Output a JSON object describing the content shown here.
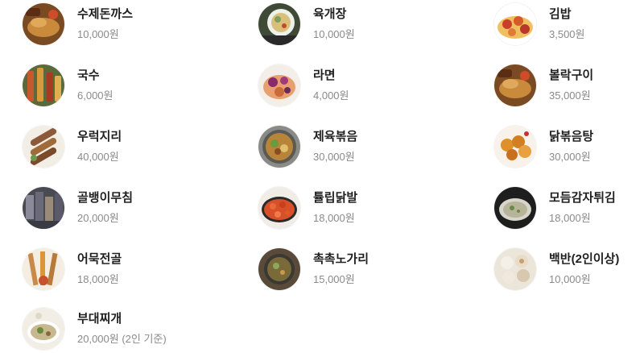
{
  "menu": {
    "items": [
      {
        "name": "수제돈까스",
        "price": "10,000원",
        "icon": "pork-cutlet-photo"
      },
      {
        "name": "육개장",
        "price": "10,000원",
        "icon": "spicy-beef-soup-photo"
      },
      {
        "name": "김밥",
        "price": "3,500원",
        "icon": "gimbap-photo"
      },
      {
        "name": "국수",
        "price": "6,000원",
        "icon": "noodles-photo"
      },
      {
        "name": "라면",
        "price": "4,000원",
        "icon": "ramen-photo"
      },
      {
        "name": "볼락구이",
        "price": "35,000원",
        "icon": "grilled-rockfish-photo"
      },
      {
        "name": "우럭지리",
        "price": "40,000원",
        "icon": "rockfish-soup-photo"
      },
      {
        "name": "제육볶음",
        "price": "30,000원",
        "icon": "stir-fried-pork-photo"
      },
      {
        "name": "닭볶음탕",
        "price": "30,000원",
        "icon": "braised-chicken-photo"
      },
      {
        "name": "골뱅이무침",
        "price": "20,000원",
        "icon": "sea-snail-salad-photo"
      },
      {
        "name": "튤립닭발",
        "price": "18,000원",
        "icon": "chicken-feet-photo"
      },
      {
        "name": "모듬감자튀김",
        "price": "18,000원",
        "icon": "assorted-fries-photo"
      },
      {
        "name": "어묵전골",
        "price": "18,000원",
        "icon": "fishcake-hotpot-photo"
      },
      {
        "name": "촉촉노가리",
        "price": "15,000원",
        "icon": "dried-pollack-photo"
      },
      {
        "name": "백반(2인이상)",
        "price": "10,000원",
        "icon": "set-meal-photo"
      },
      {
        "name": "부대찌개",
        "price": "20,000원 (2인 기준)",
        "icon": "army-stew-photo"
      }
    ]
  }
}
